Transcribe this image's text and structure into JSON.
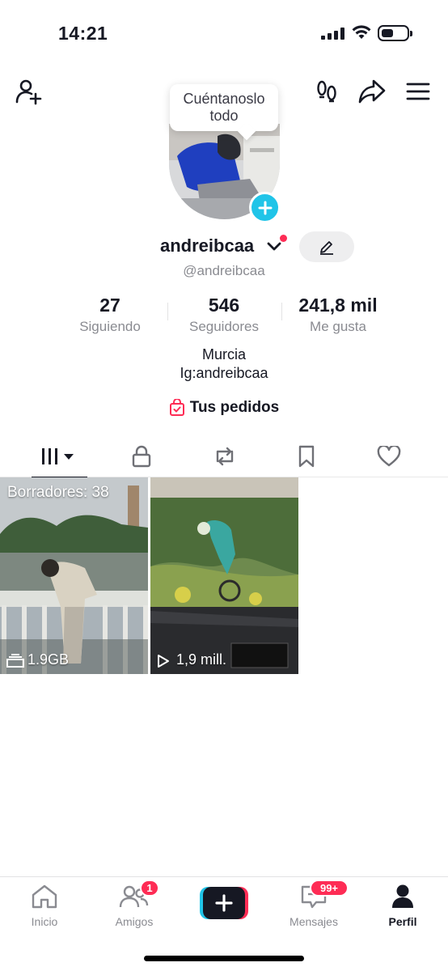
{
  "status_bar": {
    "time": "14:21"
  },
  "tooltip": {
    "text_line1": "Cuéntanoslo",
    "text_line2": "todo"
  },
  "profile": {
    "username": "andreibcaa",
    "handle": "@andreibcaa",
    "bio_line1": "Murcia",
    "bio_line2": "Ig:andreibcaa",
    "orders_label": "Tus pedidos"
  },
  "stats": [
    {
      "value": "27",
      "label": "Siguiendo"
    },
    {
      "value": "546",
      "label": "Seguidores"
    },
    {
      "value": "241,8 mil",
      "label": "Me gusta"
    }
  ],
  "videos": [
    {
      "overlay_top": "Borradores: 38",
      "overlay_bottom": "1.9GB",
      "icon": "drafts-icon"
    },
    {
      "overlay_bottom": "1,9 mill.",
      "icon": "play-icon"
    }
  ],
  "bottom_nav": {
    "items": [
      {
        "label": "Inicio",
        "icon": "home-icon"
      },
      {
        "label": "Amigos",
        "icon": "friends-icon",
        "badge": "1"
      },
      {
        "label": "",
        "icon": "create-icon"
      },
      {
        "label": "Mensajes",
        "icon": "inbox-icon",
        "badge": "99+"
      },
      {
        "label": "Perfil",
        "icon": "profile-icon"
      }
    ]
  },
  "colors": {
    "accent": "#fe2c55",
    "cyan": "#20c4e8",
    "text": "#161823",
    "muted": "#8a8b91"
  }
}
